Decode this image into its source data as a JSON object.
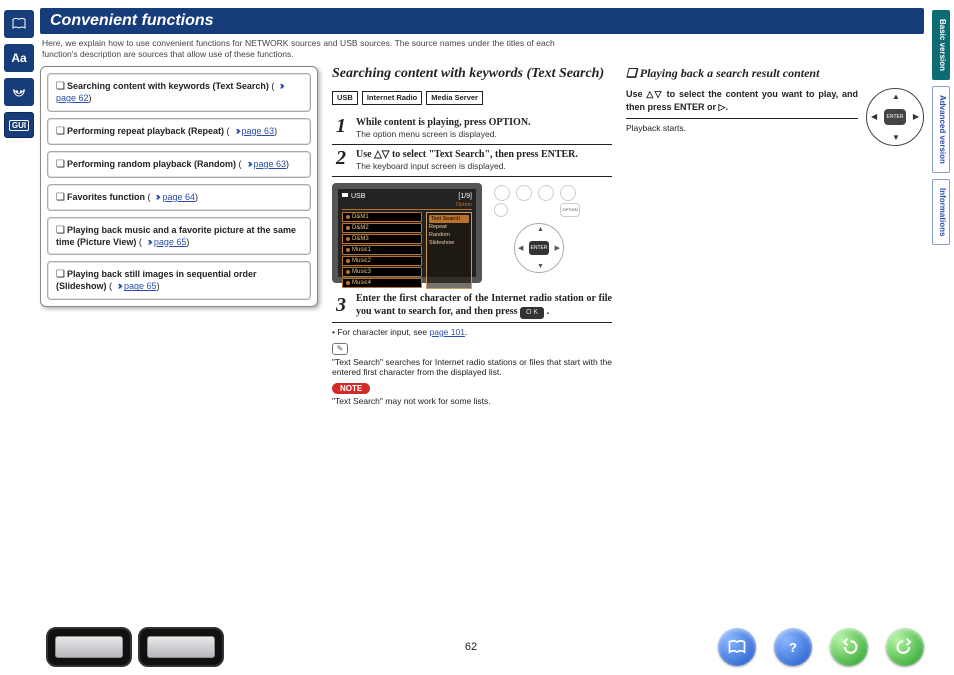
{
  "title": "Convenient functions",
  "intro": "Here, we explain how to use convenient functions for NETWORK sources and USB sources. The source names under the titles of each function's description are sources that allow use of these functions.",
  "rail": {
    "item1": "book",
    "item2": "Aa",
    "item3": "mask",
    "item4": "GUI"
  },
  "toc": [
    {
      "label": "Searching content with keywords (Text Search)",
      "page": "page 62"
    },
    {
      "label": "Performing repeat playback (Repeat)",
      "page": "page 63"
    },
    {
      "label": "Performing random playback (Random)",
      "page": "page 63"
    },
    {
      "label": "Favorites function",
      "page": "page 64"
    },
    {
      "label": "Playing back music and a favorite picture at the same time (Picture View)",
      "page": "page 65"
    },
    {
      "label": "Playing back still images in sequential order (Slideshow)",
      "page": "page 65"
    }
  ],
  "mid": {
    "heading": "Searching content with keywords (Text Search)",
    "badges": [
      "USB",
      "Internet Radio",
      "Media Server"
    ],
    "step1_main": "While content is playing, press ",
    "step1_btn": "OPTION",
    "step1_sub": "The option menu screen is displayed.",
    "step2_pre": "Use ",
    "step2_mid": " to select \"Text Search\", then press ",
    "step2_btn": "ENTER",
    "step2_sub": "The keyboard input screen is displayed.",
    "tv_header_left": "USB",
    "tv_header_right": "[1/9]",
    "tv_sub": "Option",
    "tv_list": [
      "D&M1",
      "D&M2",
      "D&M3",
      "Music1",
      "Music2",
      "Music3",
      "Music4"
    ],
    "tv_menu": [
      "Text Search",
      "Repeat",
      "Random",
      "Slideshow"
    ],
    "tv_center": "ENTER",
    "step3": "Enter the first character of the Internet radio station or file you want to search for, and then press ",
    "ok": "O K",
    "char_input_pre": "For character input, see ",
    "char_input_link": "page 101",
    "tip": "\"Text Search\" searches for Internet radio stations or files that start with the entered first character from the displayed list.",
    "note_label": "NOTE",
    "note_text": "\"Text Search\" may not work for some lists."
  },
  "right": {
    "heading": "Playing back a search result content",
    "body_pre": "Use ",
    "body_mid": " to select the content you want to play, and then press ",
    "body_btn": "ENTER",
    "body_or": " or ",
    "sub": "Playback starts.",
    "dpad_center": "ENTER"
  },
  "tabs": [
    "Basic version",
    "Advanced version",
    "Informations"
  ],
  "footer": {
    "page": "62"
  }
}
